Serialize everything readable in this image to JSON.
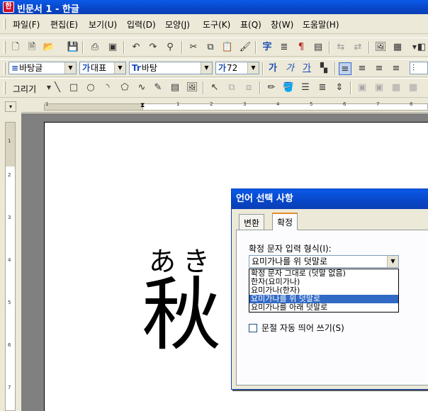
{
  "titlebar": {
    "icon_glyph": "한",
    "title": "빈문서 1 - 한글"
  },
  "menubar": {
    "items": [
      "파일(F)",
      "편집(E)",
      "보기(U)",
      "입력(D)",
      "모양(J)",
      "도구(K)",
      "표(Q)",
      "창(W)",
      "도움말(H)"
    ]
  },
  "toolbar1": {
    "icons": [
      "new-doc",
      "open-doc",
      "open-folder",
      "save",
      "print",
      "print-preview",
      "undo",
      "redo",
      "find",
      "cut",
      "copy",
      "paste",
      "format-painter",
      "hanja",
      "char-shape",
      "para-shape",
      "style",
      "table",
      "more"
    ]
  },
  "format_toolbar": {
    "style_value": "바탕글",
    "style_prefix": "≡",
    "lang_value": "대표",
    "lang_prefix": "가",
    "font_value": "바탕",
    "font_prefix": "Tr",
    "size_value": "72",
    "size_prefix": "가",
    "bold": "가",
    "italic": "가",
    "underline": "가"
  },
  "draw_toolbar": {
    "draw_label": "그리기"
  },
  "ruler": {
    "corner": "▾",
    "h_numbers": [
      "1",
      "1",
      "2",
      "3",
      "4",
      "5",
      "6",
      "7",
      "8"
    ],
    "v_numbers": [
      "1",
      "2",
      "3",
      "4",
      "5",
      "6",
      "7"
    ]
  },
  "document": {
    "ruby_text": "あき",
    "base_text": "秋"
  },
  "dialog": {
    "title": "언어 선택 사항",
    "tabs": [
      "변환",
      "확정"
    ],
    "active_tab": 1,
    "field_label": "확정 문자 입력 형식(I):",
    "selected_value": "요미가나를 위 덧말로",
    "options": [
      "확정 문자 그대로 (덧말 없음)",
      "한자(요미가나)",
      "요미가나(한자)",
      "요미가나를 위 덧말로",
      "요미가나를 아래 덧말로"
    ],
    "selected_index": 3,
    "checkbox_label": "문절 자동 띄어 쓰기(S)",
    "checkbox_checked": false
  }
}
